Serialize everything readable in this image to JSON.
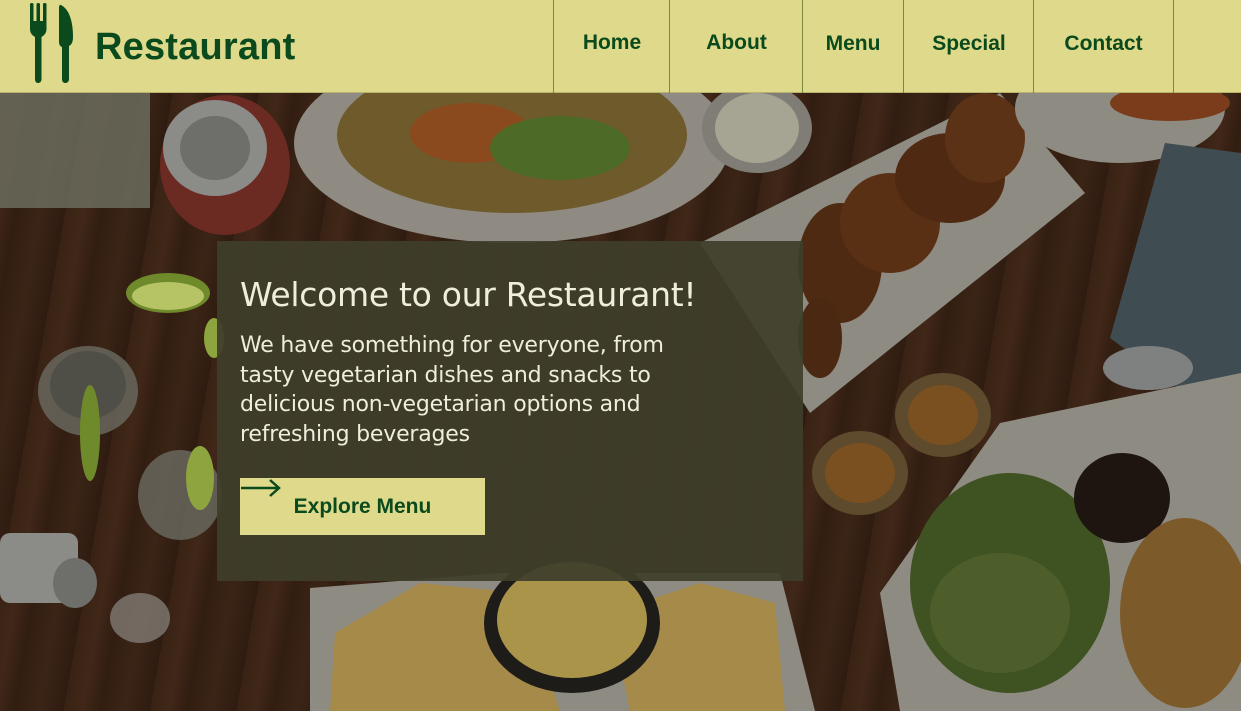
{
  "brand": {
    "name": "Restaurant",
    "colors": {
      "header_bg": "#dfd98b",
      "brand_green": "#0b4a1c",
      "card_bg": "#3e3e2a"
    }
  },
  "nav": {
    "items": [
      {
        "label": "Home"
      },
      {
        "label": "About"
      },
      {
        "label": "Menu"
      },
      {
        "label": "Special"
      },
      {
        "label": "Contact"
      }
    ]
  },
  "hero": {
    "title": "Welcome to our Restaurant!",
    "description": "We have something for everyone, from tasty vegetarian dishes and snacks to delicious non-vegetarian options and refreshing beverages",
    "cta_label": "Explore Menu",
    "cta_icon": "arrow-right-icon",
    "background_image": "food-table-photo"
  }
}
